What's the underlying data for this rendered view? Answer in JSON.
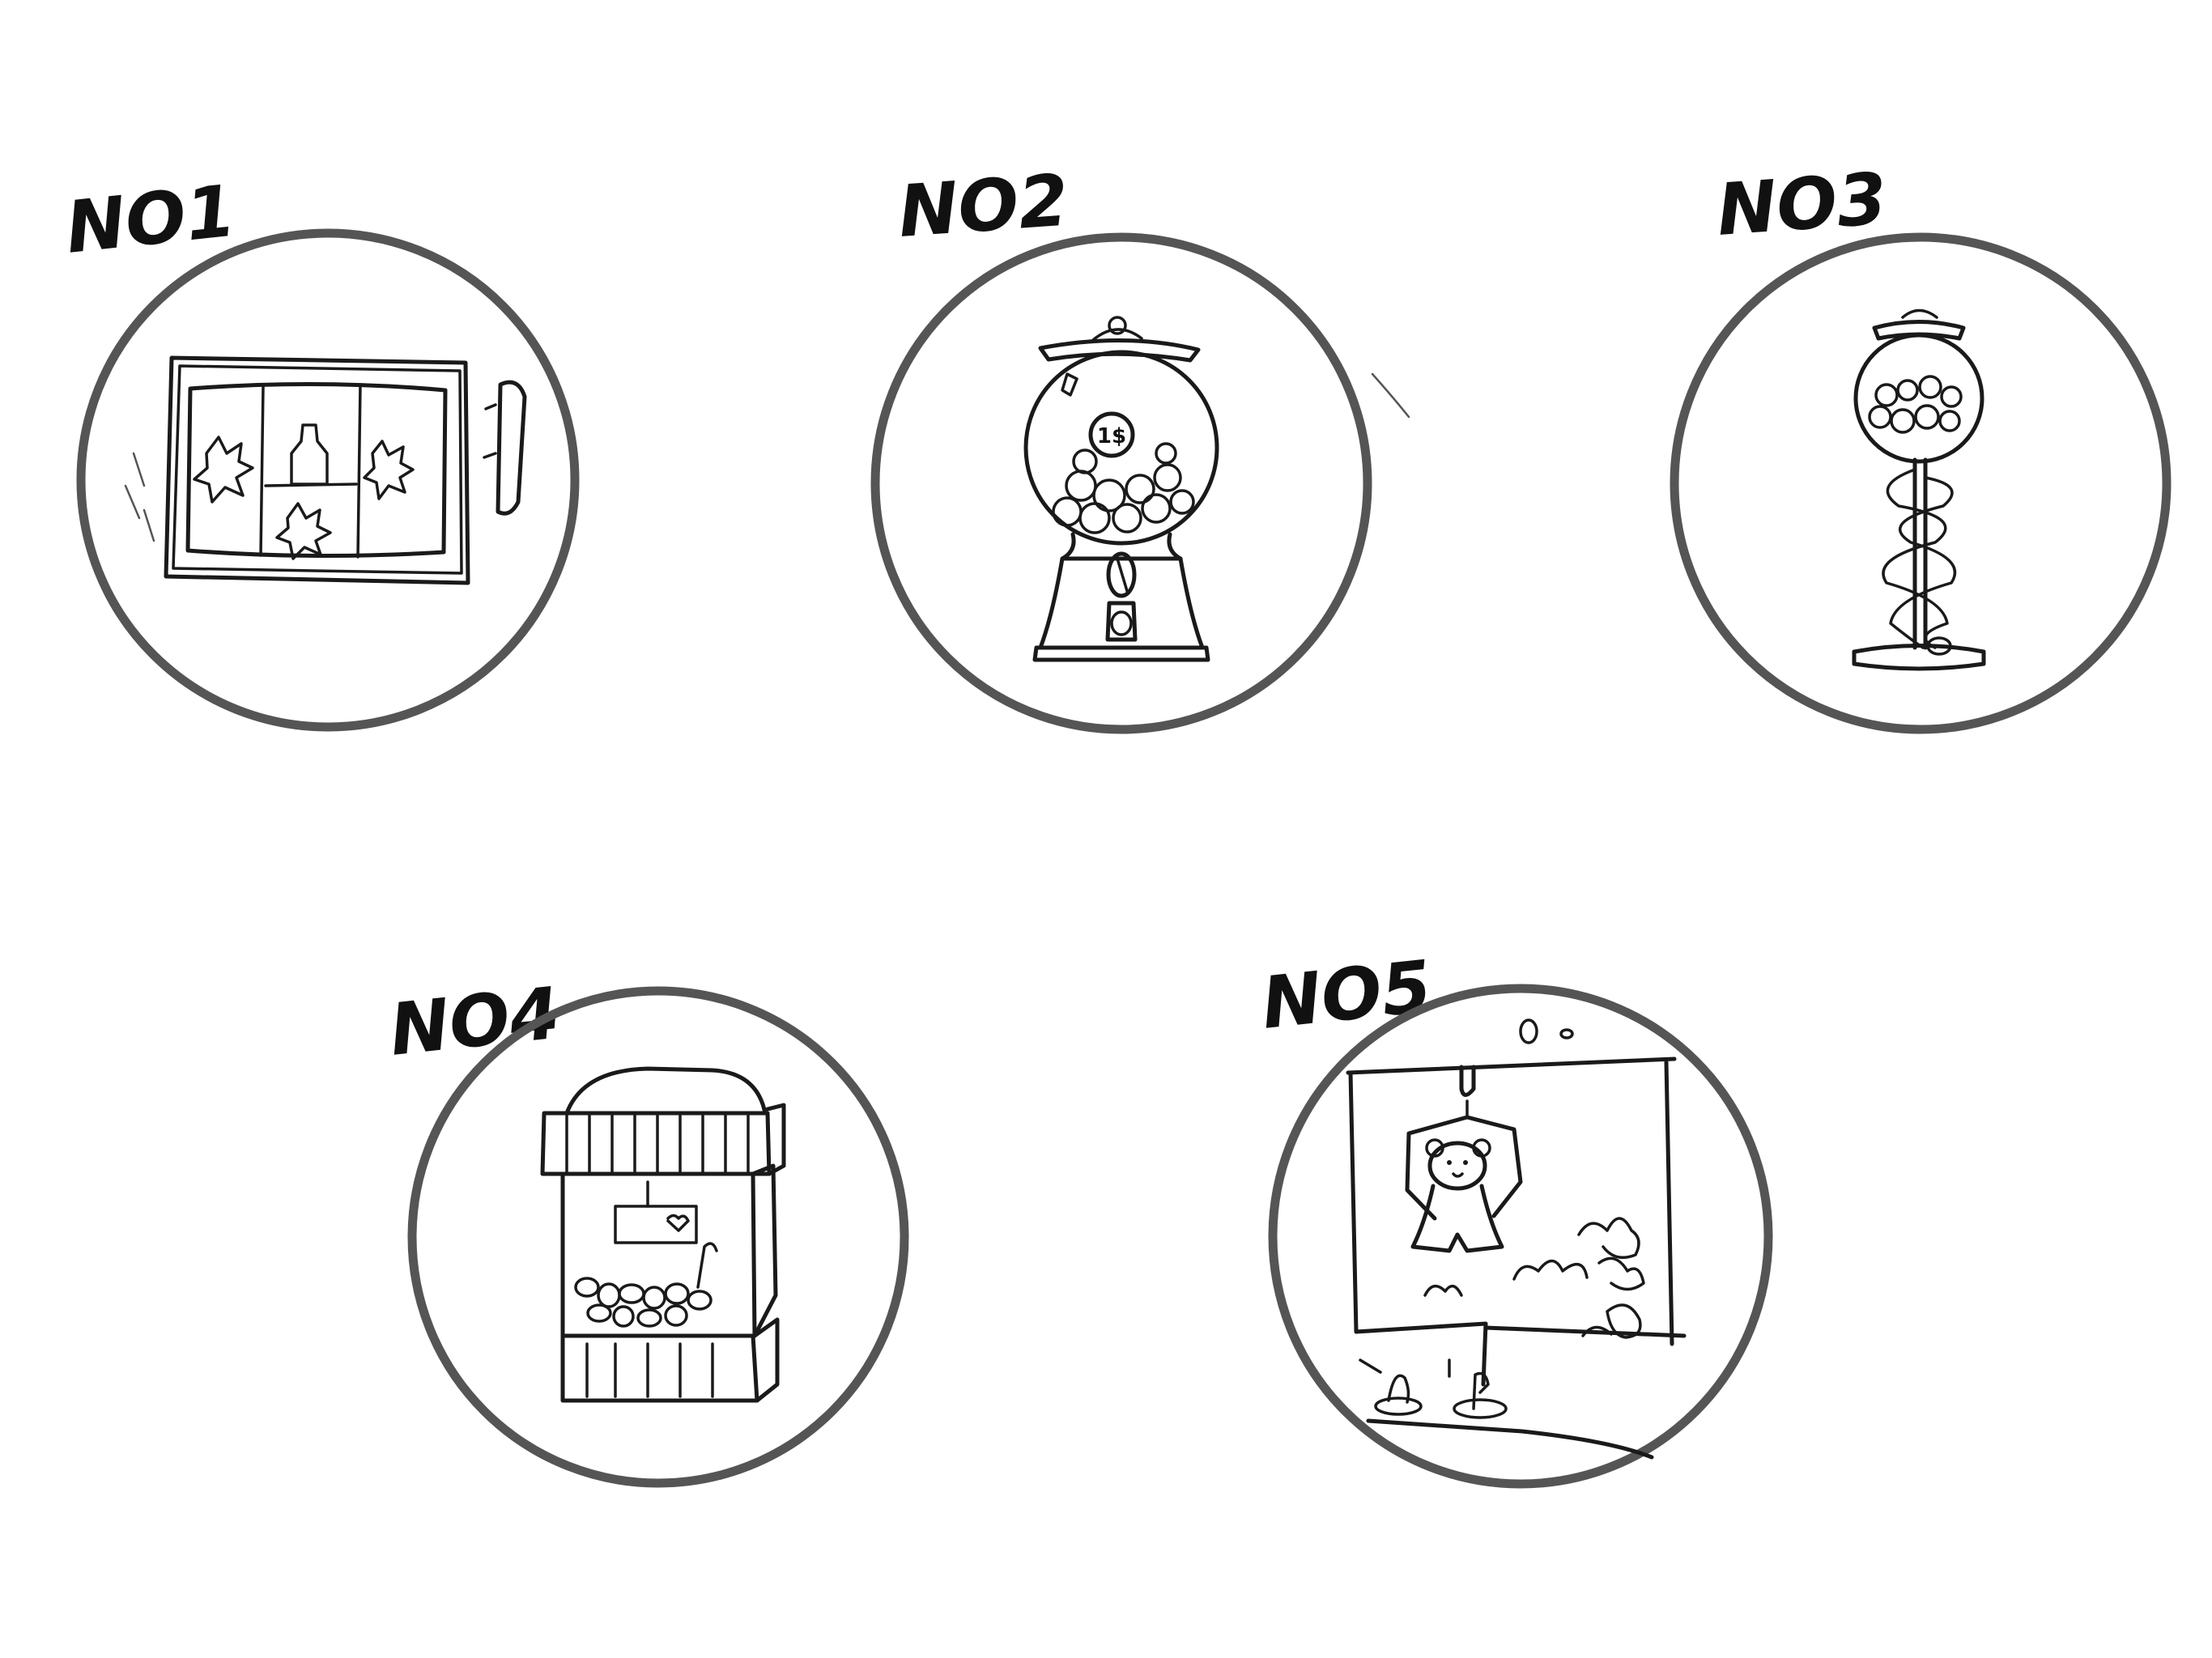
{
  "sketches": [
    {
      "label": "NO1",
      "subject": "slot-machine"
    },
    {
      "label": "NO2",
      "subject": "gumball-machine",
      "coin_text": "1$"
    },
    {
      "label": "NO3",
      "subject": "spiral-gumball-machine"
    },
    {
      "label": "NO4",
      "subject": "claw-machine"
    },
    {
      "label": "NO5",
      "subject": "claw-machine-interior"
    }
  ],
  "colors": {
    "background": "#ffffff",
    "ink": "#1a1a1a",
    "ring": "#555555"
  }
}
